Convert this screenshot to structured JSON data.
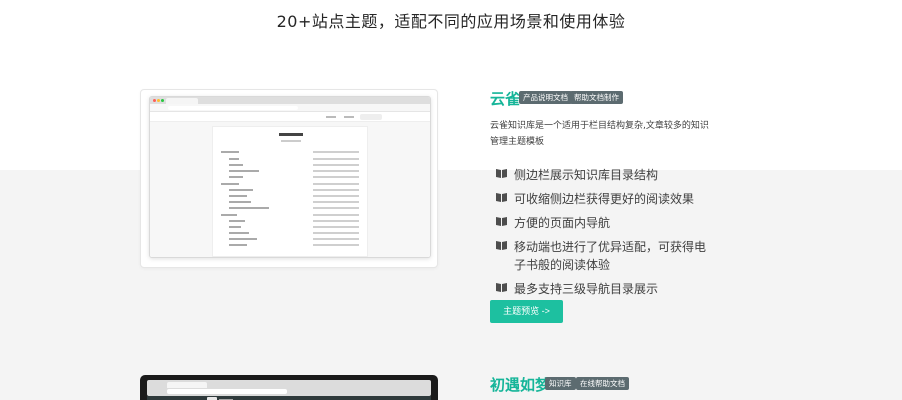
{
  "page_title": "20+站点主题，适配不同的应用场景和使用体验",
  "themes": [
    {
      "name": "云雀",
      "tags": [
        "产品说明文档",
        "帮助文档制作"
      ],
      "description": "云雀知识库是一个适用于栏目结构复杂,文章较多的知识管理主题模板",
      "features": [
        "侧边栏展示知识库目录结构",
        "可收缩侧边栏获得更好的阅读效果",
        "方便的页面内导航",
        "移动端也进行了优异适配，可获得电子书般的阅读体验",
        "最多支持三级导航目录展示"
      ],
      "cta": "主题预览 ->"
    },
    {
      "name": "初遇如梦",
      "tags": [
        "知识库",
        "在线帮助文档"
      ]
    }
  ],
  "colors": {
    "accent": "#16b599",
    "button": "#1dc0a0",
    "tag_bg": "#5c6b70"
  },
  "icons": {
    "feature_bullet": "book-icon"
  }
}
